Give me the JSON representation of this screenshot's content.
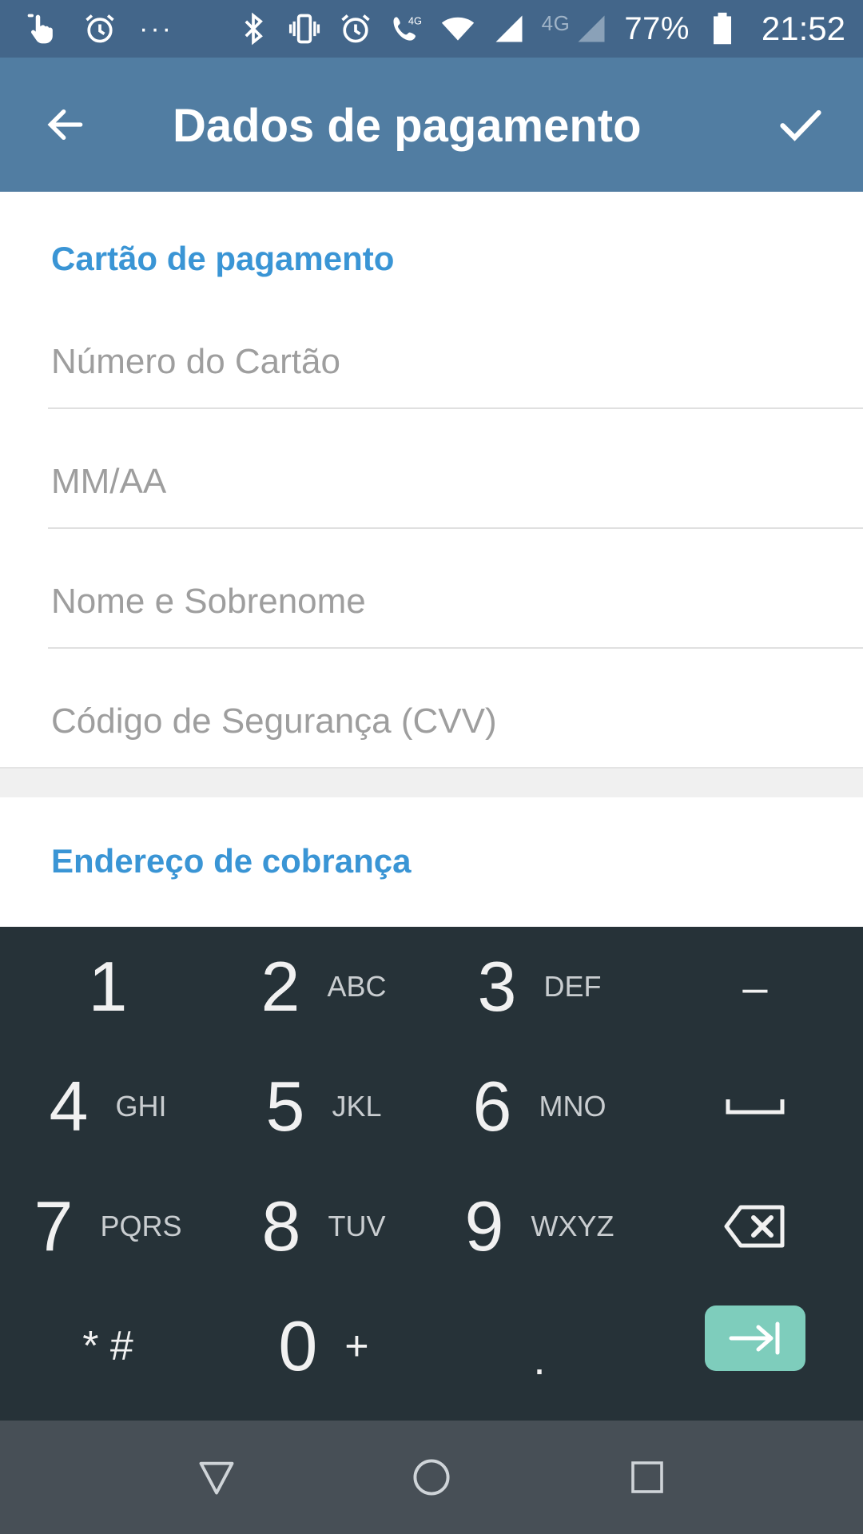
{
  "status_bar": {
    "battery": "77%",
    "time": "21:52",
    "dots": "···",
    "network_4g": "4G",
    "network_4g_2": "4G"
  },
  "app_bar": {
    "title": "Dados de pagamento",
    "back_icon": "arrow-back-icon",
    "done_icon": "check-icon"
  },
  "card_section": {
    "header": "Cartão de pagamento",
    "fields": [
      {
        "placeholder": "Número do Cartão",
        "value": ""
      },
      {
        "placeholder": "MM/AA",
        "value": ""
      },
      {
        "placeholder": "Nome e Sobrenome",
        "value": ""
      },
      {
        "placeholder": "Código de Segurança (CVV)",
        "value": ""
      }
    ]
  },
  "billing_section": {
    "header": "Endereço de cobrança"
  },
  "keyboard": {
    "rows": [
      [
        {
          "digit": "1",
          "letters": ""
        },
        {
          "digit": "2",
          "letters": "ABC"
        },
        {
          "digit": "3",
          "letters": "DEF"
        },
        {
          "symbol": "–"
        }
      ],
      [
        {
          "digit": "4",
          "letters": "GHI"
        },
        {
          "digit": "5",
          "letters": "JKL"
        },
        {
          "digit": "6",
          "letters": "MNO"
        },
        {
          "symbol": "space"
        }
      ],
      [
        {
          "digit": "7",
          "letters": "PQRS"
        },
        {
          "digit": "8",
          "letters": "TUV"
        },
        {
          "digit": "9",
          "letters": "WXYZ"
        },
        {
          "symbol": "backspace"
        }
      ],
      [
        {
          "symbol": "* #"
        },
        {
          "digit": "0",
          "letters": "+"
        },
        {
          "symbol": "."
        },
        {
          "symbol": "next"
        }
      ]
    ],
    "accent_color": "#7ecdbc"
  },
  "colors": {
    "status_bar": "#43668a",
    "app_bar": "#517da2",
    "section_header": "#3a95d5",
    "keyboard_bg": "#263238",
    "nav_bar": "#474f56"
  }
}
